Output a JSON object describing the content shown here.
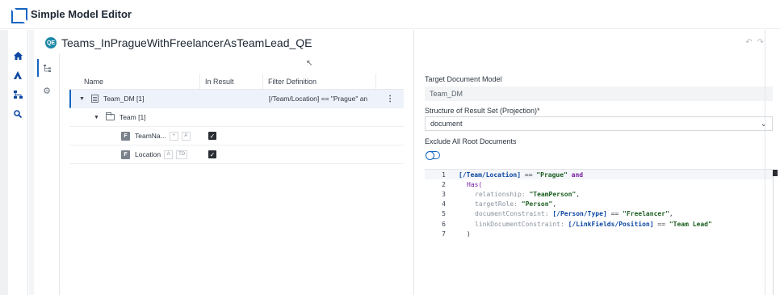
{
  "app": {
    "title": "Simple Model Editor"
  },
  "query": {
    "badge": "QE",
    "name": "Teams_InPragueWithFreelancerAsTeamLead_QE"
  },
  "tree": {
    "headers": {
      "name": "Name",
      "in_result": "In Result",
      "filter": "Filter Definition"
    },
    "rows": [
      {
        "label": "Team_DM [1]",
        "filter": "[/Team/Location] == \"Prague\" an"
      },
      {
        "label": "Team [1]"
      },
      {
        "label": "TeamNa...",
        "badge": "F",
        "tags": [
          "+",
          "A"
        ],
        "checked": true
      },
      {
        "label": "Location",
        "badge": "F",
        "tags": [
          "A",
          "TD"
        ],
        "checked": true
      }
    ]
  },
  "right": {
    "target_label": "Target Document Model",
    "target_value": "Team_DM",
    "structure_label": "Structure of Result Set (Projection)*",
    "structure_value": "document",
    "exclude_label": "Exclude All Root Documents"
  },
  "code": {
    "line_numbers": [
      "1",
      "2",
      "3",
      "4",
      "5",
      "6",
      "7"
    ],
    "l1": {
      "a": "[/Team/Location]",
      "b": " == ",
      "c": "\"Prague\"",
      "d": " and"
    },
    "l2": {
      "a": "Has("
    },
    "l3": {
      "k": "relationship: ",
      "v": "\"TeamPerson\"",
      "p": ","
    },
    "l4": {
      "k": "targetRole: ",
      "v": "\"Person\"",
      "p": ","
    },
    "l5": {
      "k": "documentConstraint: ",
      "a": "[/Person/Type]",
      "b": " == ",
      "v": "\"Freelancer\"",
      "p": ","
    },
    "l6": {
      "k": "linkDocumentConstraint: ",
      "a": "[/LinkFields/Position]",
      "b": " == ",
      "v": "\"Team Lead\""
    },
    "l7": {
      "a": ")"
    }
  },
  "colors": {
    "accent": "#1565c0",
    "code_path": "#0d47a1",
    "code_string": "#1b5e20",
    "code_keyword": "#7b1fa2",
    "code_key": "#8a929c"
  }
}
